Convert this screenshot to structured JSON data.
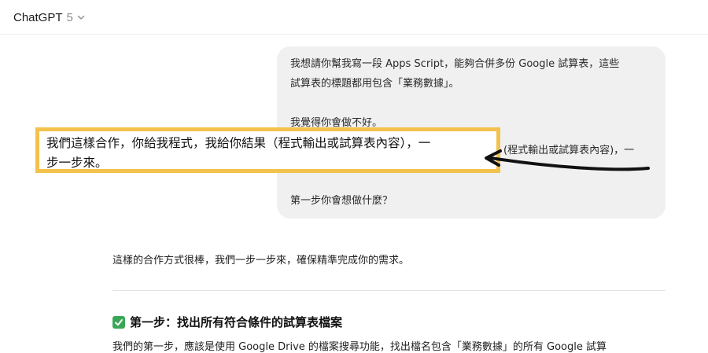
{
  "header": {
    "app_title": "ChatGPT",
    "model_version": "5"
  },
  "user_message": {
    "line1": "我想請你幫我寫一段 Apps Script，能夠合併多份 Google 試算表，這些",
    "line2": "試算表的標題都用包含「業務數據」。",
    "line3": "我覺得你會做不好。",
    "peek": "(程式輸出或試算表內容)，一",
    "line_last": "第一步你會想做什麼？"
  },
  "highlight": {
    "line1": "我們這樣合作，你給我程式，我給你結果（程式輸出或試算表內容），一",
    "line2": "步一步來。"
  },
  "assistant": {
    "reply": "這樣的合作方式很棒，我們一步一步來，確保精準完成你的需求。",
    "step_heading": "第一步：找出所有符合條件的試算表檔案",
    "cut_line": "我們的第一步，應該是使用 Google Drive 的檔案搜尋功能，找出檔名包含「業務數據」的所有 Google 試算"
  },
  "colors": {
    "highlight_border": "#f2c24d",
    "bubble_bg": "#f0f0f0",
    "check_green": "#3aa757"
  }
}
